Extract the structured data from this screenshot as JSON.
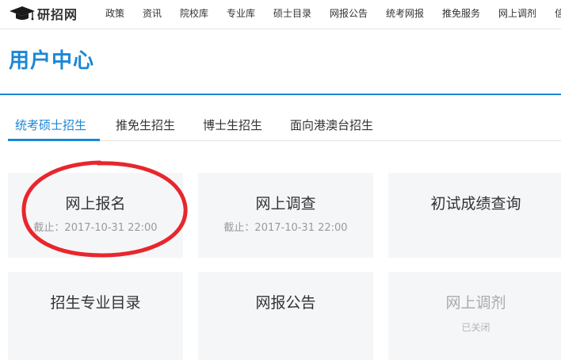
{
  "brand": {
    "logo_text": "研招网",
    "logo_icon": "graduation-cap-icon"
  },
  "nav": {
    "items": [
      "政策",
      "资讯",
      "院校库",
      "专业库",
      "硕士目录",
      "网报公告",
      "统考网报",
      "推免服务",
      "网上调剂",
      "信"
    ]
  },
  "page": {
    "title": "用户中心"
  },
  "tabs": [
    {
      "label": "统考硕士招生",
      "active": true
    },
    {
      "label": "推免生招生",
      "active": false
    },
    {
      "label": "博士生招生",
      "active": false
    },
    {
      "label": "面向港澳台招生",
      "active": false
    }
  ],
  "cards": [
    {
      "title": "网上报名",
      "subtitle": "截止：2017-10-31 22:00",
      "enabled": true
    },
    {
      "title": "网上调查",
      "subtitle": "截止：2017-10-31 22:00",
      "enabled": true
    },
    {
      "title": "初试成绩查询",
      "subtitle": "",
      "enabled": true
    },
    {
      "title": "招生专业目录",
      "subtitle": "",
      "enabled": true
    },
    {
      "title": "网报公告",
      "subtitle": "",
      "enabled": true
    },
    {
      "title": "网上调剂",
      "subtitle": "已关闭",
      "enabled": false
    }
  ],
  "colors": {
    "accent": "#1b87d6",
    "card_bg": "#f5f6f8",
    "annotation": "#e8262d"
  }
}
